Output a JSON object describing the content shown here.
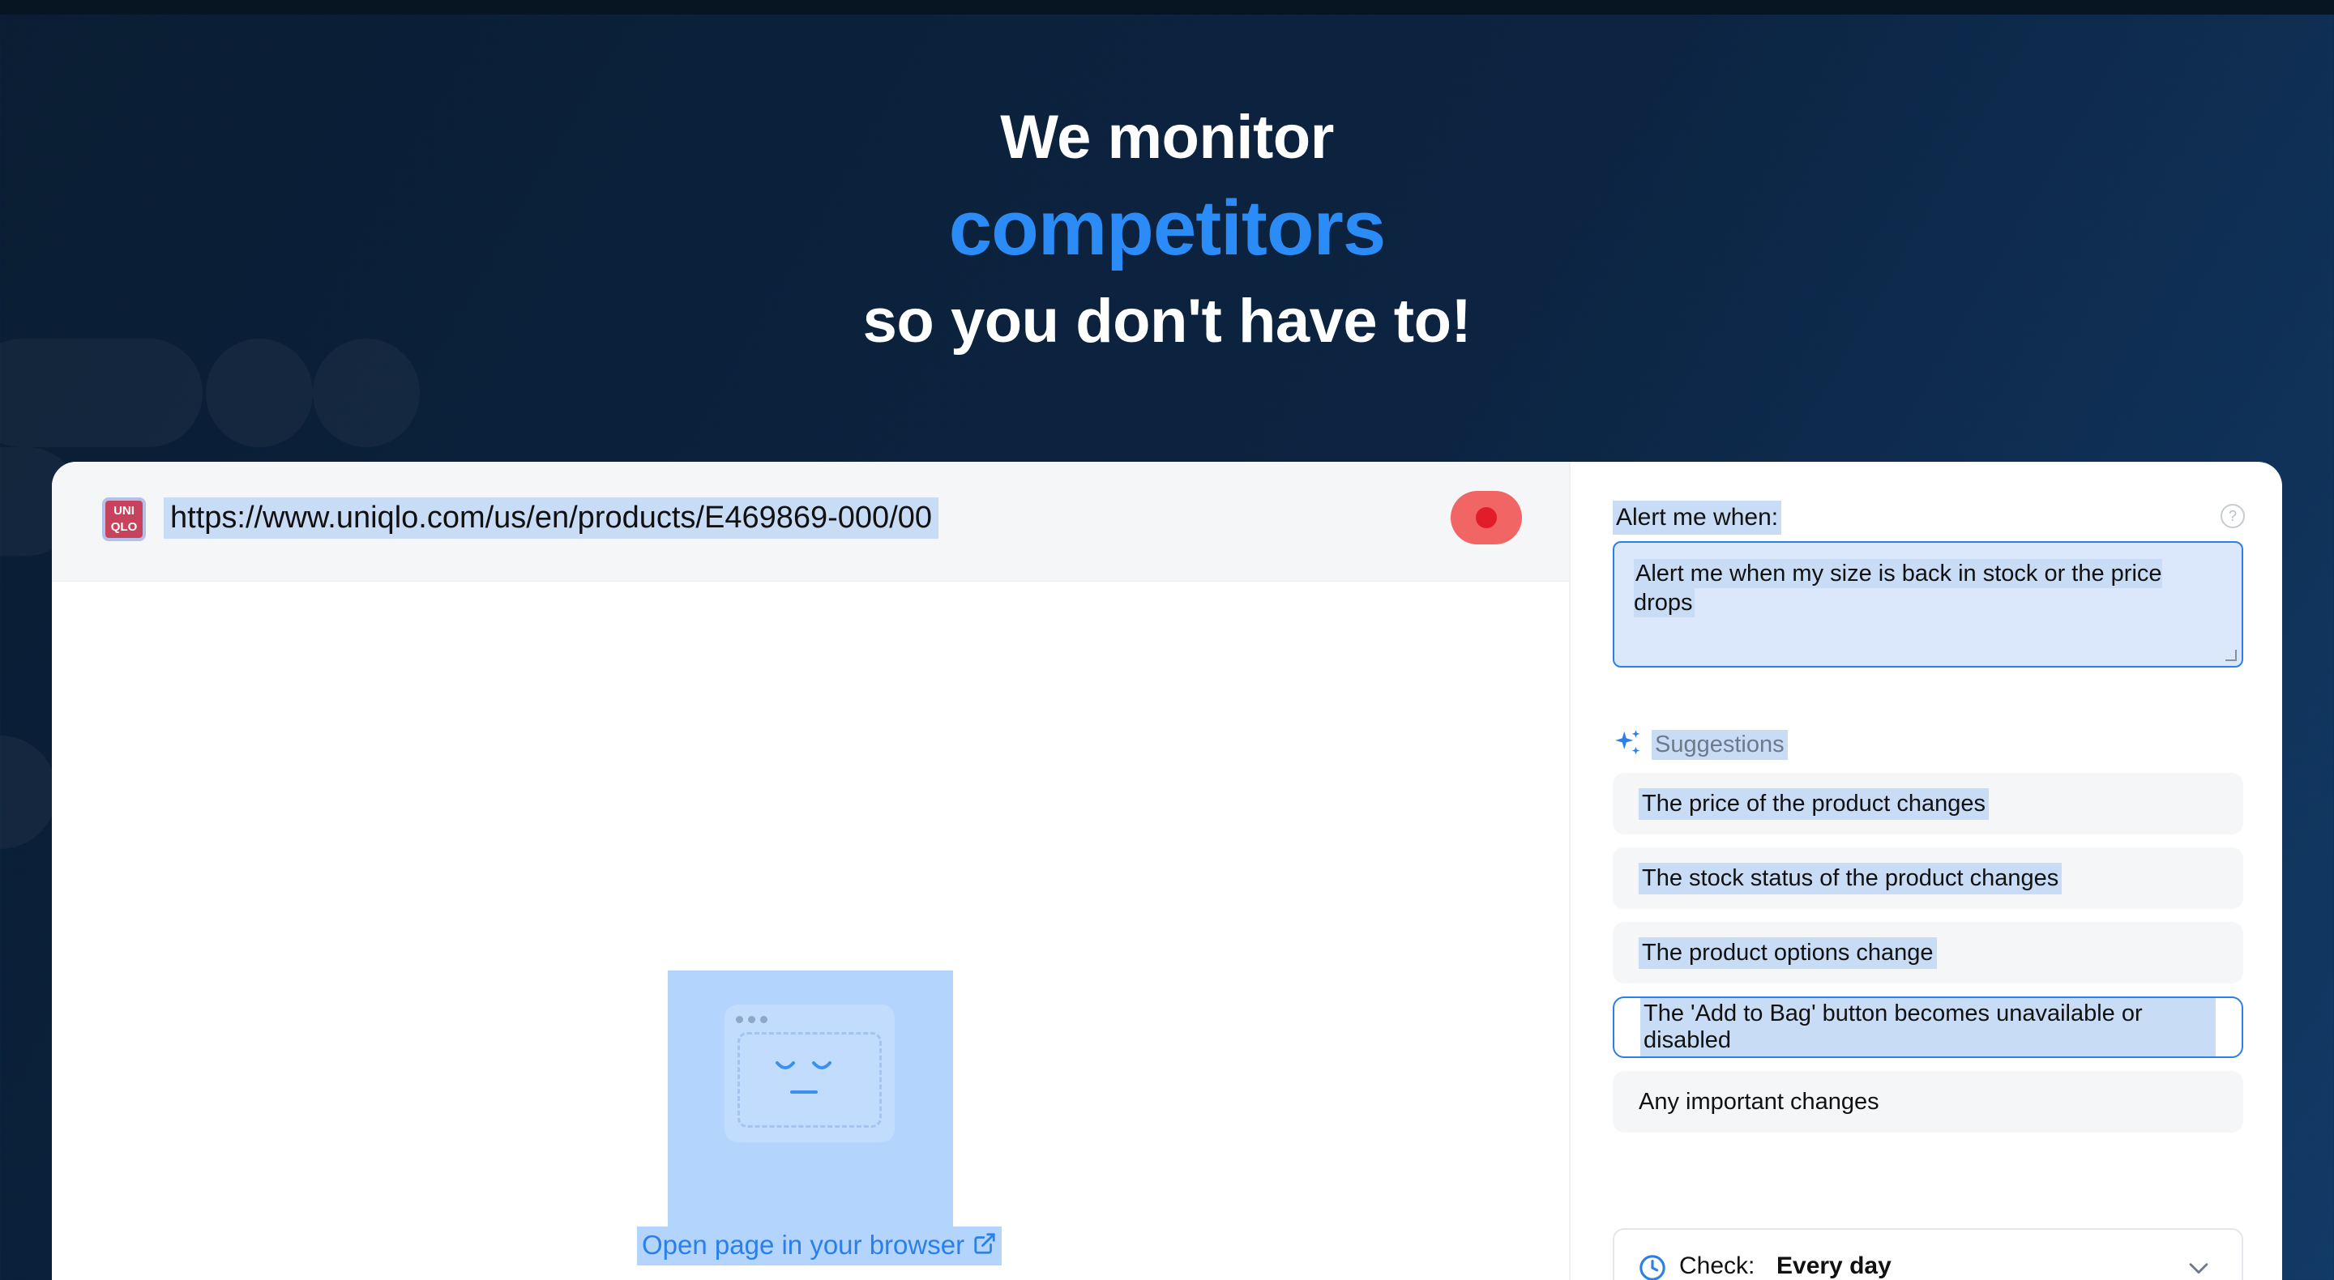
{
  "hero": {
    "line1": "We monitor",
    "line2": "competitors",
    "line3": "so you don't have to!"
  },
  "browser": {
    "logo_text": "UNI QLO",
    "url": "https://www.uniqlo.com/us/en/products/E469869-000/00",
    "record_icon": "record-icon",
    "open_link_label": "Open page in your browser",
    "open_link_icon": "external-link-icon"
  },
  "panel": {
    "alert_label": "Alert me when:",
    "help_icon": "help-icon",
    "alert_text": "Alert me when my size is back in stock or the price drops",
    "suggestions_label": "Suggestions",
    "suggestions_icon": "sparkle-icon",
    "suggestions": [
      {
        "label": "The price of the product changes"
      },
      {
        "label": "The stock status of the product changes"
      },
      {
        "label": "The product options change"
      },
      {
        "label": "The 'Add to Bag' button becomes unavailable or disabled"
      },
      {
        "label": "Any important changes"
      }
    ],
    "check_label": "Check:",
    "check_value": "Every day"
  },
  "colors": {
    "accent": "#2b8cf7",
    "background": "#0c2442",
    "record": "#f26565",
    "selection": "#c9dcf6"
  }
}
